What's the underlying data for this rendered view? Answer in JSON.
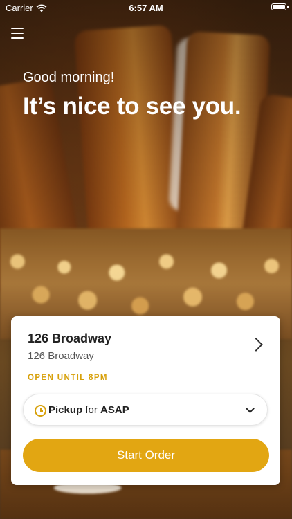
{
  "status_bar": {
    "carrier": "Carrier",
    "time": "6:57 AM",
    "battery_level": 0.95
  },
  "header": {
    "greeting": "Good morning!",
    "headline": "It’s nice to see you."
  },
  "location": {
    "name": "126 Broadway",
    "address": "126 Broadway",
    "hours": "OPEN UNTIL 8PM"
  },
  "order_mode": {
    "mode": "Pickup",
    "connector": "for",
    "time": "ASAP"
  },
  "actions": {
    "start_order": "Start Order"
  },
  "colors": {
    "accent": "#E2A612",
    "hours_text": "#D7A00A"
  },
  "icons": [
    "wifi-icon",
    "battery-icon",
    "menu-icon",
    "chevron-right-icon",
    "clock-icon",
    "chevron-down-icon"
  ]
}
